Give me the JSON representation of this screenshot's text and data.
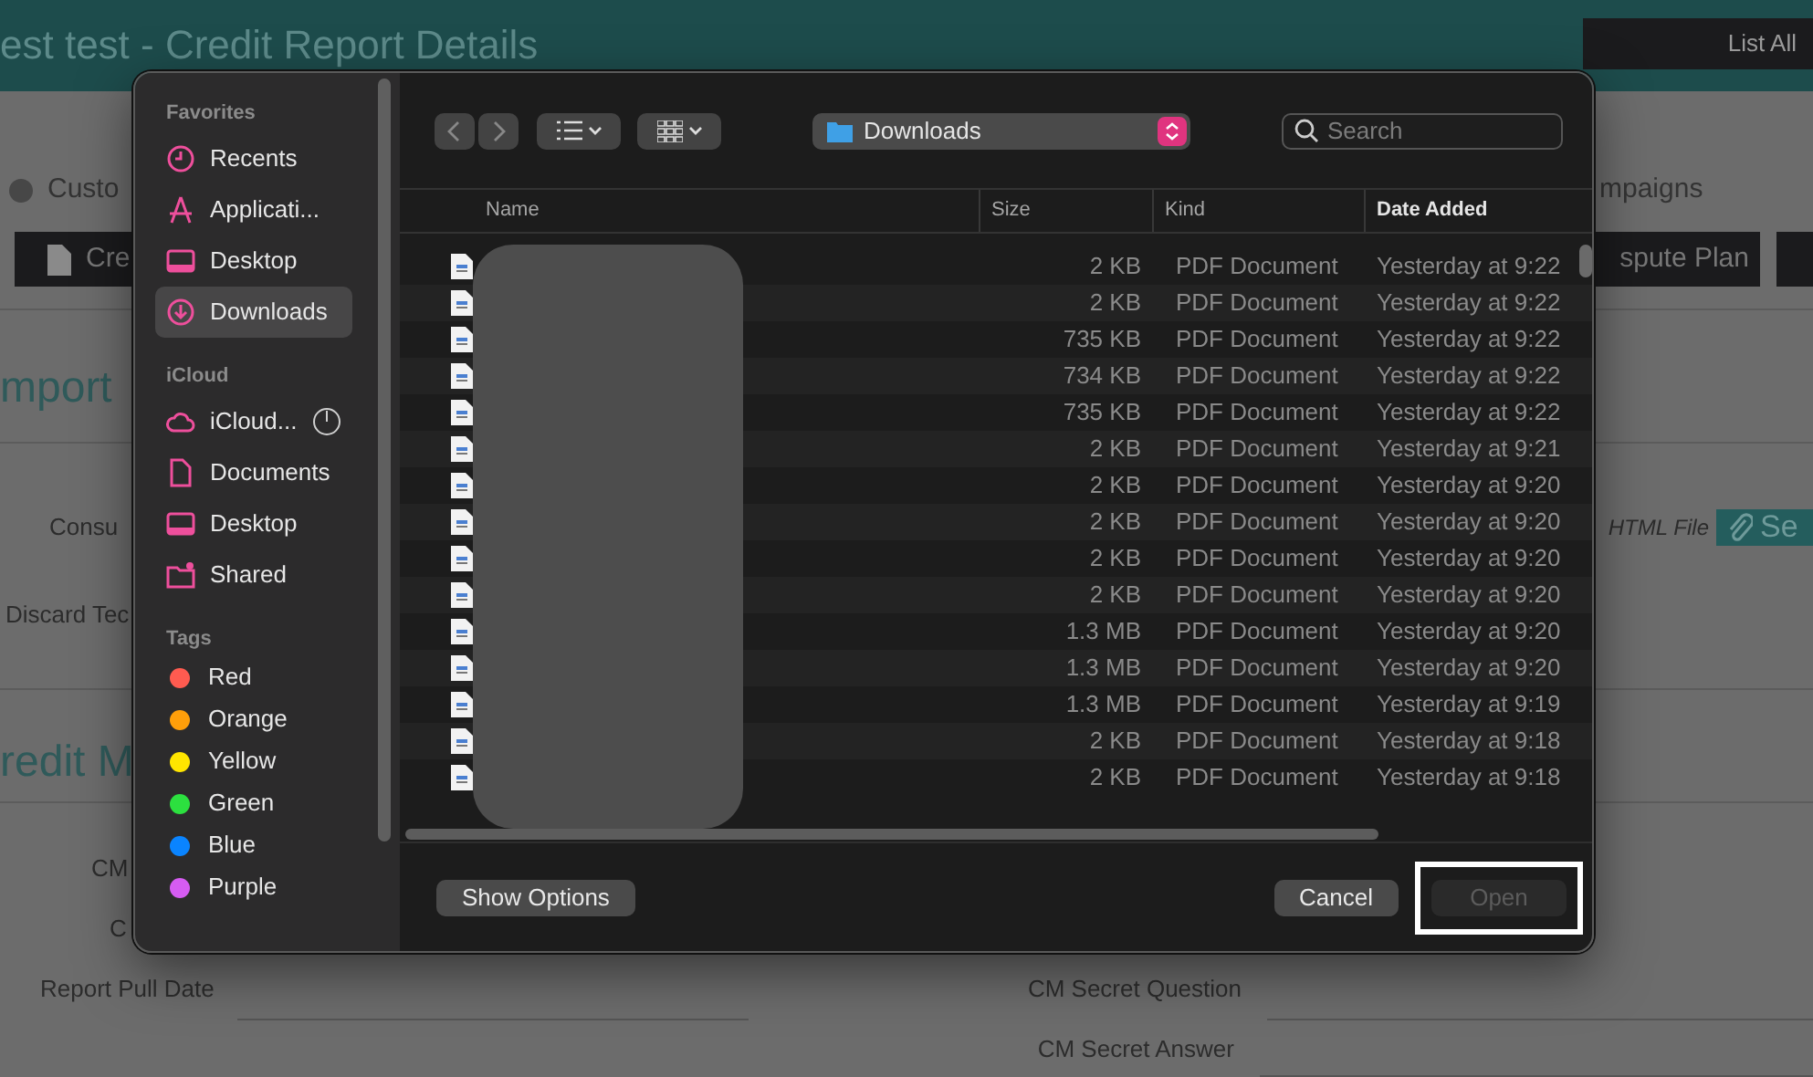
{
  "page": {
    "title": "est test - Credit Report Details",
    "list_button": "List All",
    "status_label": "Custo",
    "tab_label": "mpaigns",
    "left_button": "Cre",
    "right_button": "spute Plan",
    "section_1": "mport",
    "field_1": "Consu",
    "upload_hint": "HTML File",
    "select_button": "Se",
    "field_2": "Discard Tec",
    "section_2": "redit M",
    "field_3": "CM",
    "field_4": "C",
    "field_5": "Report Pull Date",
    "field_6": "CM Secret Question",
    "field_7": "CM Secret Answer"
  },
  "dialog": {
    "sidebar": [
      {
        "heading": "Favorites",
        "items": [
          {
            "label": "Recents",
            "selected": false
          },
          {
            "label": "Applicati...",
            "selected": false
          },
          {
            "label": "Desktop",
            "selected": false
          },
          {
            "label": "Downloads",
            "selected": true
          }
        ]
      },
      {
        "heading": "iCloud",
        "items": [
          {
            "label": "iCloud...",
            "selected": false
          },
          {
            "label": "Documents",
            "selected": false
          },
          {
            "label": "Desktop",
            "selected": false
          },
          {
            "label": "Shared",
            "selected": false
          }
        ]
      },
      {
        "heading": "Tags",
        "tags": [
          {
            "label": "Red",
            "color": "#ff5b50"
          },
          {
            "label": "Orange",
            "color": "#ff9f0a"
          },
          {
            "label": "Yellow",
            "color": "#ffe500"
          },
          {
            "label": "Green",
            "color": "#2ce03f"
          },
          {
            "label": "Blue",
            "color": "#0a84ff"
          },
          {
            "label": "Purple",
            "color": "#d65cf2"
          }
        ]
      }
    ],
    "location": "Downloads",
    "search": {
      "placeholder": "Search"
    },
    "columns": [
      {
        "label": "Name",
        "sorted": false
      },
      {
        "label": "Size",
        "sorted": false
      },
      {
        "label": "Kind",
        "sorted": false
      },
      {
        "label": "Date Added",
        "sorted": true
      }
    ],
    "rows": [
      {
        "size": "2 KB",
        "kind": "PDF Document",
        "date": "Yesterday at 9:22"
      },
      {
        "size": "2 KB",
        "kind": "PDF Document",
        "date": "Yesterday at 9:22"
      },
      {
        "size": "735 KB",
        "kind": "PDF Document",
        "date": "Yesterday at 9:22"
      },
      {
        "size": "734 KB",
        "kind": "PDF Document",
        "date": "Yesterday at 9:22"
      },
      {
        "size": "735 KB",
        "kind": "PDF Document",
        "date": "Yesterday at 9:22"
      },
      {
        "size": "2 KB",
        "kind": "PDF Document",
        "date": "Yesterday at 9:21"
      },
      {
        "size": "2 KB",
        "kind": "PDF Document",
        "date": "Yesterday at 9:20"
      },
      {
        "size": "2 KB",
        "kind": "PDF Document",
        "date": "Yesterday at 9:20"
      },
      {
        "size": "2 KB",
        "kind": "PDF Document",
        "date": "Yesterday at 9:20"
      },
      {
        "size": "2 KB",
        "kind": "PDF Document",
        "date": "Yesterday at 9:20"
      },
      {
        "size": "1.3 MB",
        "kind": "PDF Document",
        "date": "Yesterday at 9:20"
      },
      {
        "size": "1.3 MB",
        "kind": "PDF Document",
        "date": "Yesterday at 9:20"
      },
      {
        "size": "1.3 MB",
        "kind": "PDF Document",
        "date": "Yesterday at 9:19"
      },
      {
        "size": "2 KB",
        "kind": "PDF Document",
        "date": "Yesterday at 9:18"
      },
      {
        "size": "2 KB",
        "kind": "PDF Document",
        "date": "Yesterday at 9:18"
      }
    ],
    "buttons": [
      {
        "label": "Show Options",
        "disabled": false,
        "highlighted": false
      },
      {
        "label": "Cancel",
        "disabled": false,
        "highlighted": false
      },
      {
        "label": "Open",
        "disabled": true,
        "highlighted": true
      }
    ]
  }
}
